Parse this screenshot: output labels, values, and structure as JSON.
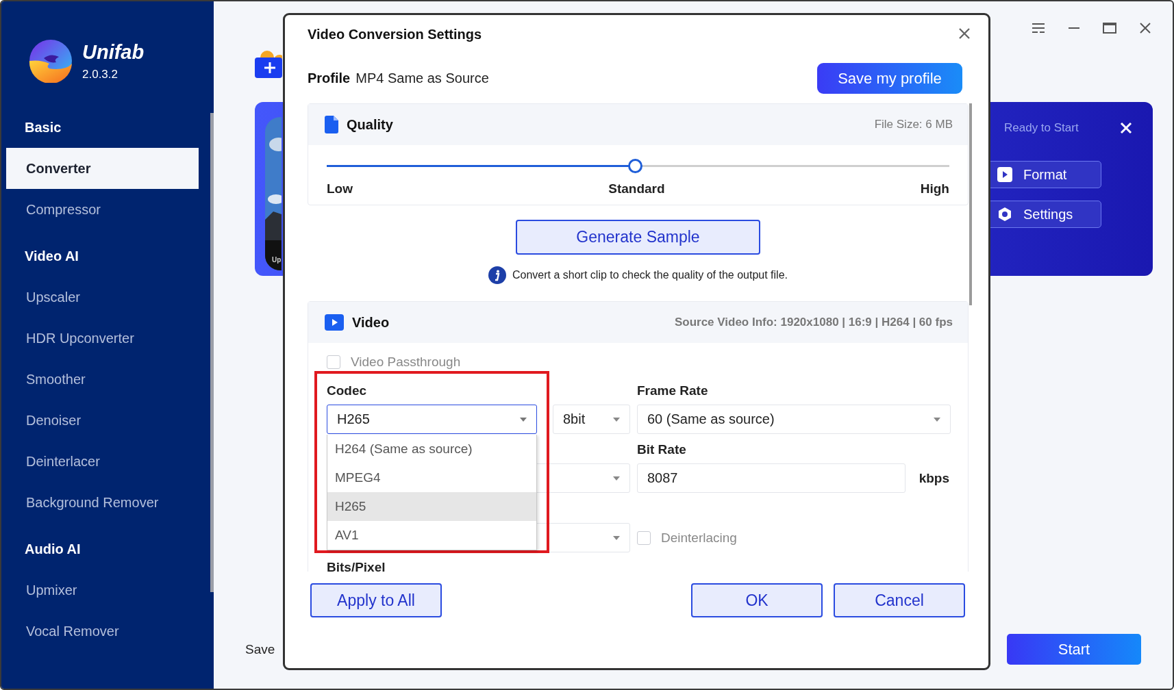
{
  "app": {
    "name": "Unifab",
    "version": "2.0.3.2"
  },
  "window_controls": [
    {
      "kind": "menu"
    },
    {
      "kind": "minimize"
    },
    {
      "kind": "maximize"
    },
    {
      "kind": "close"
    }
  ],
  "sidebar": {
    "sections": [
      {
        "title": "Basic",
        "items": [
          {
            "label": "Converter",
            "selected": true
          },
          {
            "label": "Compressor",
            "selected": false
          }
        ]
      },
      {
        "title": "Video AI",
        "items": [
          {
            "label": "Upscaler",
            "selected": false
          },
          {
            "label": "HDR Upconverter",
            "selected": false
          },
          {
            "label": "Smoother",
            "selected": false
          },
          {
            "label": "Denoiser",
            "selected": false
          },
          {
            "label": "Deinterlacer",
            "selected": false
          },
          {
            "label": "Background Remover",
            "selected": false
          }
        ]
      },
      {
        "title": "Audio AI",
        "items": [
          {
            "label": "Upmixer",
            "selected": false
          },
          {
            "label": "Vocal Remover",
            "selected": false
          }
        ]
      }
    ]
  },
  "main": {
    "thumbnail_label": "Up",
    "task": {
      "status": "Ready to Start",
      "buttons": [
        {
          "label": "Format",
          "kind": "format"
        },
        {
          "label": "Settings",
          "kind": "settings"
        }
      ]
    },
    "save_label": "Save",
    "start_button": "Start"
  },
  "dialog": {
    "title": "Video Conversion Settings",
    "profile_label": "Profile",
    "profile_value": "MP4 Same as Source",
    "save_profile_button": "Save my profile",
    "quality": {
      "title": "Quality",
      "file_size_label": "File Size:",
      "file_size": "6 MB",
      "level": 0.495,
      "marks": [
        "Low",
        "Standard",
        "High"
      ]
    },
    "generate_button": "Generate Sample",
    "hint": "Convert a short clip to check the quality of the output file.",
    "video": {
      "title": "Video",
      "source_info": "Source Video Info: 1920x1080 | 16:9 | H264 | 60 fps",
      "passthrough": {
        "label": "Video Passthrough",
        "checked": false
      },
      "codec": {
        "label": "Codec",
        "value": "H265",
        "expanded": true,
        "options": [
          {
            "label": "H264 (Same as source)",
            "selected": false
          },
          {
            "label": "MPEG4",
            "selected": false
          },
          {
            "label": "H265",
            "selected": true
          },
          {
            "label": "AV1",
            "selected": false
          }
        ]
      },
      "bit_depth": {
        "value": "8bit"
      },
      "frame_rate": {
        "label": "Frame Rate",
        "value": "60 (Same as source)"
      },
      "bit_rate": {
        "label": "Bit Rate",
        "value": "8087",
        "unit": "kbps"
      },
      "deinterlacing": {
        "label": "Deinterlacing",
        "checked": false
      },
      "bits_per_pixel_label": "Bits/Pixel"
    },
    "buttons": [
      {
        "label": "Apply to All"
      },
      {
        "label": "OK"
      },
      {
        "label": "Cancel"
      }
    ]
  }
}
